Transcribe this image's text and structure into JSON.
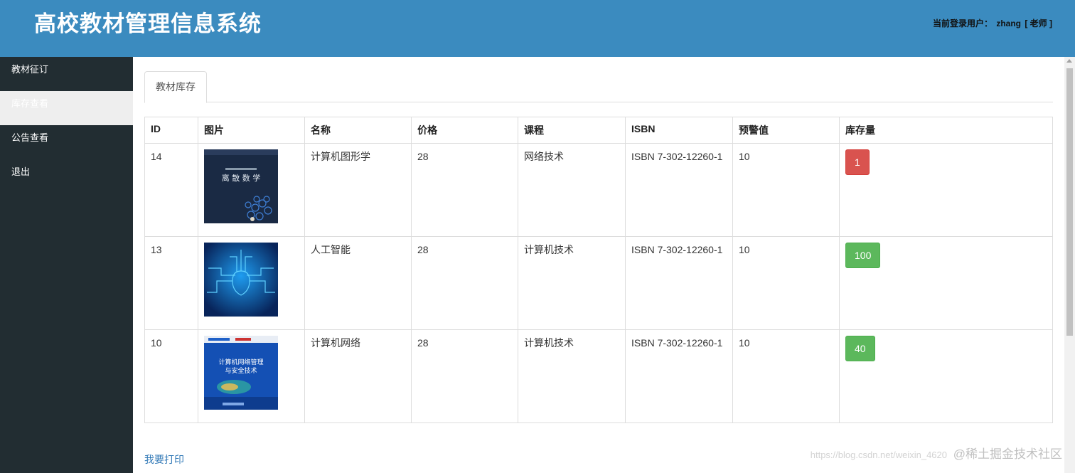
{
  "header": {
    "title": "高校教材管理信息系统",
    "user_label": "当前登录用户：",
    "user_name": "zhang",
    "user_role": "[ 老师 ]"
  },
  "sidebar": {
    "items": [
      {
        "label": "教材征订",
        "active": false
      },
      {
        "label": "库存查看",
        "active": true
      },
      {
        "label": "公告查看",
        "active": false
      },
      {
        "label": "退出",
        "active": false
      }
    ]
  },
  "tabs": [
    {
      "label": "教材库存",
      "active": true
    }
  ],
  "table": {
    "columns": [
      "ID",
      "图片",
      "名称",
      "价格",
      "课程",
      "ISBN",
      "预警值",
      "库存量"
    ],
    "rows": [
      {
        "id": "14",
        "image": "离散数学 book cover",
        "name": "计算机图形学",
        "price": "28",
        "course": "网络技术",
        "isbn": "ISBN 7-302-12260-1",
        "warning": "10",
        "stock": "1",
        "stock_status": "danger"
      },
      {
        "id": "13",
        "image": "blue circuit book cover",
        "name": "人工智能",
        "price": "28",
        "course": "计算机技术",
        "isbn": "ISBN 7-302-12260-1",
        "warning": "10",
        "stock": "100",
        "stock_status": "success"
      },
      {
        "id": "10",
        "image": "计算机网络管理与安全技术 book cover",
        "name": "计算机网络",
        "price": "28",
        "course": "计算机技术",
        "isbn": "ISBN 7-302-12260-1",
        "warning": "10",
        "stock": "40",
        "stock_status": "success"
      }
    ]
  },
  "print_link": "我要打印",
  "watermark": {
    "url": "https://blog.csdn.net/weixin_4620",
    "text": "@稀土掘金技术社区"
  },
  "colors": {
    "header_bg": "#3b8bbf",
    "sidebar_bg": "#222d32",
    "danger": "#d9534f",
    "success": "#5cb85c",
    "link": "#337ab7"
  }
}
